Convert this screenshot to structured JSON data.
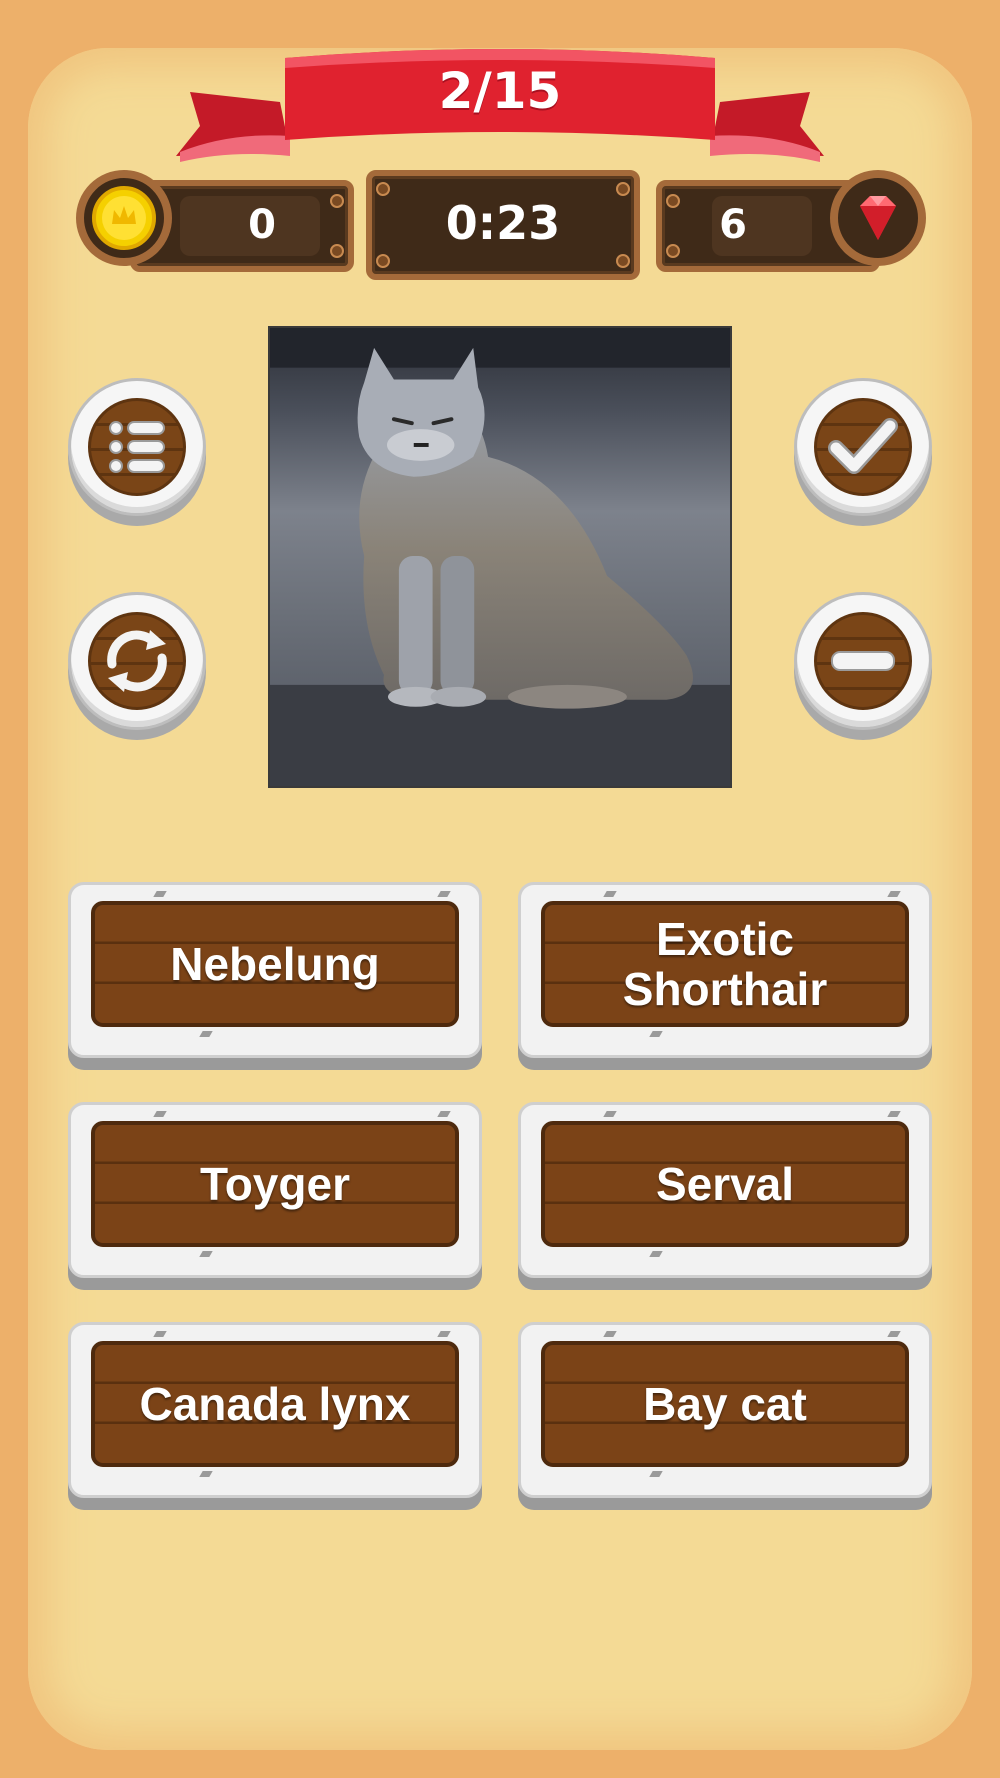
{
  "header": {
    "progress_label": "2/15",
    "question_number": 2,
    "question_total": 15
  },
  "stats": {
    "coins": "0",
    "timer": "0:23",
    "gems": "6"
  },
  "side_buttons": {
    "left": [
      "menu-list",
      "restart"
    ],
    "right": [
      "check",
      "remove"
    ]
  },
  "question": {
    "image_subject": "lynx photo"
  },
  "answers": [
    {
      "label": "Nebelung"
    },
    {
      "label": "Exotic\nShorthair"
    },
    {
      "label": "Toyger"
    },
    {
      "label": "Serval"
    },
    {
      "label": "Canada lynx"
    },
    {
      "label": "Bay cat"
    }
  ],
  "colors": {
    "background": "#EDB06A",
    "panel": "#F4DA95",
    "ribbon": "#E0222F",
    "wood": "#7B4317",
    "coin": "#F5D000",
    "gem": "#E8323C"
  }
}
